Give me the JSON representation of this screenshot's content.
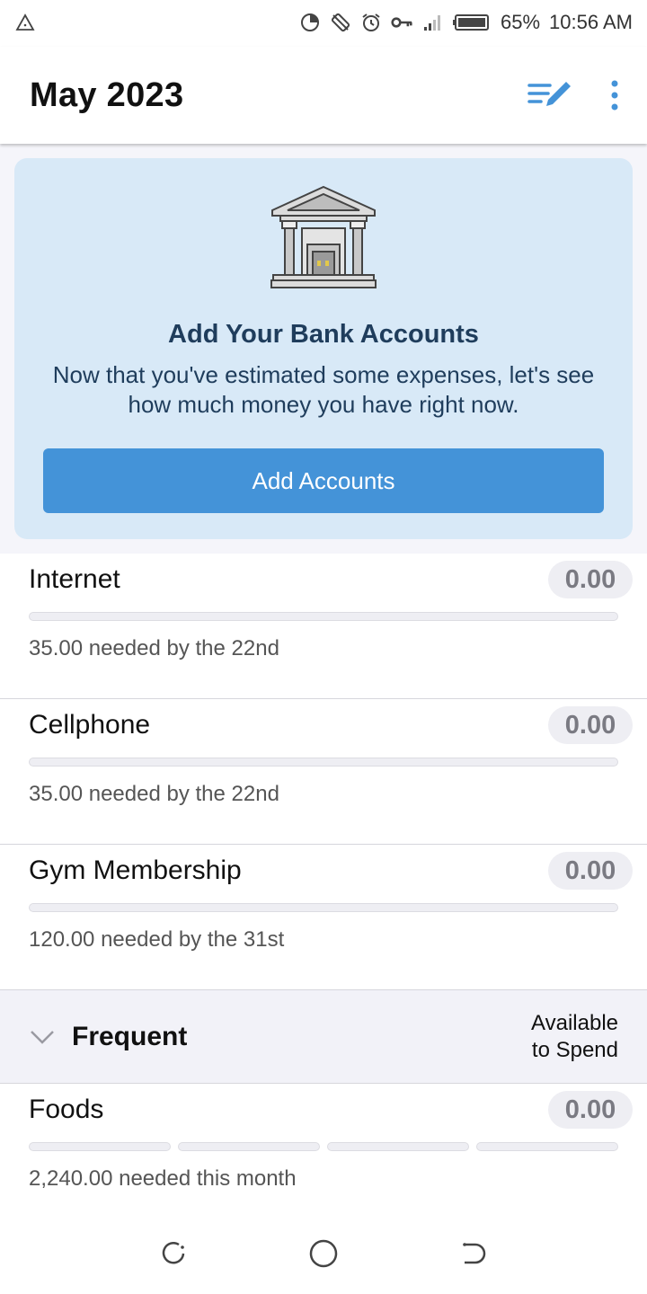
{
  "status_bar": {
    "battery": "65%",
    "time": "10:56 AM"
  },
  "header": {
    "title": "May 2023",
    "icons": [
      "edit-list-icon",
      "more-vert-icon"
    ]
  },
  "banner": {
    "icon": "bank-icon",
    "title": "Add Your Bank Accounts",
    "description": "Now that you've estimated some expenses, let's see how much money you have right now.",
    "button_label": "Add Accounts"
  },
  "items": [
    {
      "name": "Internet",
      "amount": "0.00",
      "subtitle": "35.00 needed by the 22nd",
      "progress": 0
    },
    {
      "name": "Cellphone",
      "amount": "0.00",
      "subtitle": "35.00 needed by the 22nd",
      "progress": 0
    },
    {
      "name": "Gym Membership",
      "amount": "0.00",
      "subtitle": "120.00 needed by the 31st",
      "progress": 0
    }
  ],
  "frequent_section": {
    "title": "Frequent",
    "right_line1": "Available",
    "right_line2": "to Spend",
    "items": [
      {
        "name": "Foods",
        "amount": "0.00",
        "subtitle": "2,240.00 needed this month",
        "progress": 0
      }
    ]
  },
  "colors": {
    "accent": "#4493d8",
    "banner_bg": "#d8e9f7",
    "banner_text": "#1f3d5c"
  }
}
